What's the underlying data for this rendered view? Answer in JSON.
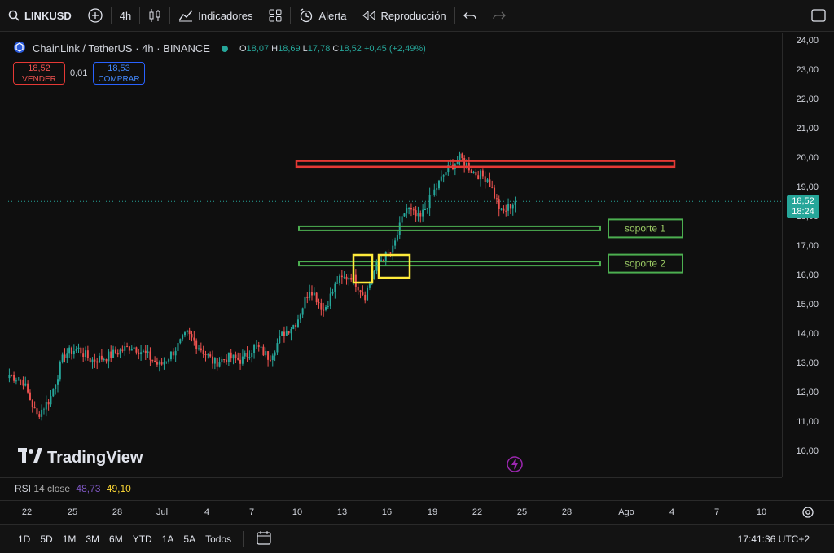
{
  "toolbar": {
    "symbol": "LINKUSD",
    "interval": "4h",
    "indicators_label": "Indicadores",
    "alert_label": "Alerta",
    "replay_label": "Reproducción"
  },
  "legend": {
    "title": "ChainLink / TetherUS · 4h · BINANCE",
    "o_key": "O",
    "o": "18,07",
    "h_key": "H",
    "h": "18,69",
    "l_key": "L",
    "l": "17,78",
    "c_key": "C",
    "c": "18,52",
    "change": "+0,45 (+2,49%)"
  },
  "trade": {
    "sell_price": "18,52",
    "sell_label": "VENDER",
    "spread": "0,01",
    "buy_price": "18,53",
    "buy_label": "COMPRAR"
  },
  "price_axis": [
    "24,00",
    "23,00",
    "22,00",
    "21,00",
    "20,00",
    "19,00",
    "18,00",
    "17,00",
    "16,00",
    "15,00",
    "14,00",
    "13,00",
    "12,00",
    "11,00",
    "10,00"
  ],
  "current_price": {
    "price": "18,52",
    "countdown": "18:24"
  },
  "annotations": {
    "support1": "soporte 1",
    "support2": "soporte 2"
  },
  "time_axis": [
    "22",
    "25",
    "28",
    "Jul",
    "4",
    "7",
    "10",
    "13",
    "16",
    "19",
    "22",
    "25",
    "28",
    "Ago",
    "4",
    "7",
    "10"
  ],
  "watermark": "TradingView",
  "rsi": {
    "label": "RSI",
    "params": "14 close",
    "value1": "48,73",
    "value2": "49,10"
  },
  "bottombar": {
    "ranges": [
      "1D",
      "5D",
      "1M",
      "3M",
      "6M",
      "YTD",
      "1A",
      "5A",
      "Todos"
    ],
    "clock": "17:41:36 UTC+2"
  },
  "colors": {
    "up": "#26a69a",
    "down": "#ef5350",
    "resistance": "#e53935",
    "support": "#4caf50",
    "highlight": "#ffeb3b"
  },
  "chart_data": {
    "type": "candlestick",
    "title": "ChainLink / TetherUS · 4h · BINANCE",
    "ylim": [
      10,
      24
    ],
    "x_labels": [
      "22",
      "25",
      "28",
      "Jul",
      "4",
      "7",
      "10",
      "13",
      "16",
      "19",
      "22",
      "25",
      "28",
      "Ago",
      "4",
      "7",
      "10"
    ],
    "close_trajectory": [
      12.6,
      12.4,
      11.2,
      11.8,
      13.3,
      13.5,
      13.1,
      13.2,
      13.4,
      13.6,
      13.3,
      12.9,
      13.4,
      14.0,
      13.5,
      13.0,
      13.2,
      13.1,
      13.6,
      13.2,
      14.0,
      14.4,
      15.6,
      14.8,
      15.8,
      16.0,
      15.3,
      16.5,
      16.8,
      18.3,
      17.9,
      18.8,
      19.6,
      20.0,
      19.5,
      19.3,
      18.1,
      18.52
    ],
    "resistance_zone": [
      19.7,
      19.9
    ],
    "support_levels": [
      {
        "name": "soporte 1",
        "value": 17.6
      },
      {
        "name": "soporte 2",
        "value": 16.4
      }
    ],
    "last_price": 18.52
  }
}
